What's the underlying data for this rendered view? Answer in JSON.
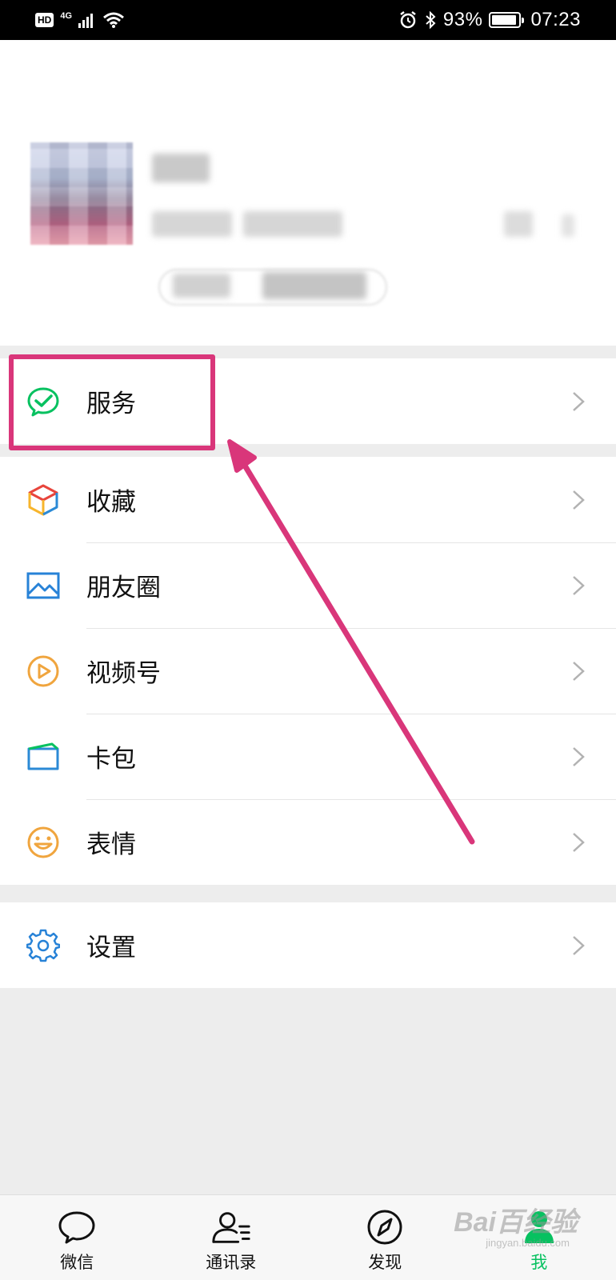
{
  "status_bar": {
    "hd": "HD",
    "network": "4G",
    "battery_text": "93%",
    "battery_level": 0.93,
    "time": "07:23"
  },
  "profile": {
    "avatar_icon": "avatar-pixelated"
  },
  "menu": {
    "group1": [
      {
        "label": "服务",
        "icon": "wechat-pay-check-icon",
        "color": "#07c160"
      }
    ],
    "group2": [
      {
        "label": "收藏",
        "icon": "cube-icon"
      },
      {
        "label": "朋友圈",
        "icon": "picture-icon",
        "color": "#2782d7"
      },
      {
        "label": "视频号",
        "icon": "play-circle-icon",
        "color": "#f0a53e"
      },
      {
        "label": "卡包",
        "icon": "wallet-card-icon",
        "color": "#2b8ad6"
      },
      {
        "label": "表情",
        "icon": "smiley-icon",
        "color": "#f0a53e"
      }
    ],
    "group3": [
      {
        "label": "设置",
        "icon": "gear-icon",
        "color": "#2782d7"
      }
    ]
  },
  "annotation": {
    "color": "#d9367a"
  },
  "tabbar": [
    {
      "label": "微信",
      "icon": "chat-bubble-icon",
      "active": false
    },
    {
      "label": "通讯录",
      "icon": "contacts-icon",
      "active": false
    },
    {
      "label": "发现",
      "icon": "compass-icon",
      "active": false
    },
    {
      "label": "我",
      "icon": "person-icon",
      "active": true,
      "color": "#07c160"
    }
  ],
  "watermark": {
    "main": "Bai百经验",
    "sub": "jingyan.baidu.com"
  }
}
